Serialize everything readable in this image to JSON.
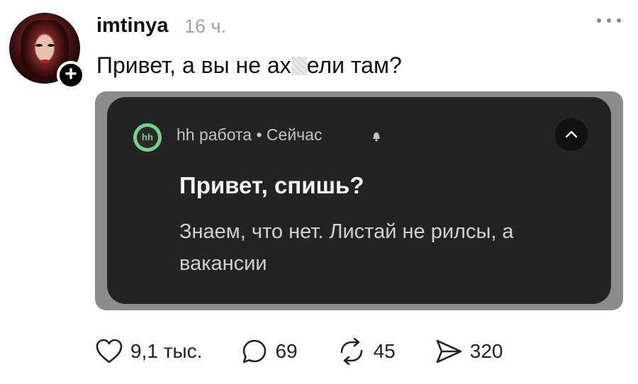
{
  "post": {
    "username": "imtinya",
    "timestamp": "16 ч.",
    "text_before": "Привет, а вы не ах",
    "text_after": "ели там?"
  },
  "notification": {
    "app_label": "hh",
    "app_name": "hh работа • Сейчас",
    "title": "Привет, спишь?",
    "body": "Знаем, что нет. Листай не рилсы, а вакансии",
    "brand_color": "#74d385"
  },
  "actions": {
    "likes": "9,1 тыс.",
    "comments": "69",
    "reposts": "45",
    "shares": "320"
  }
}
